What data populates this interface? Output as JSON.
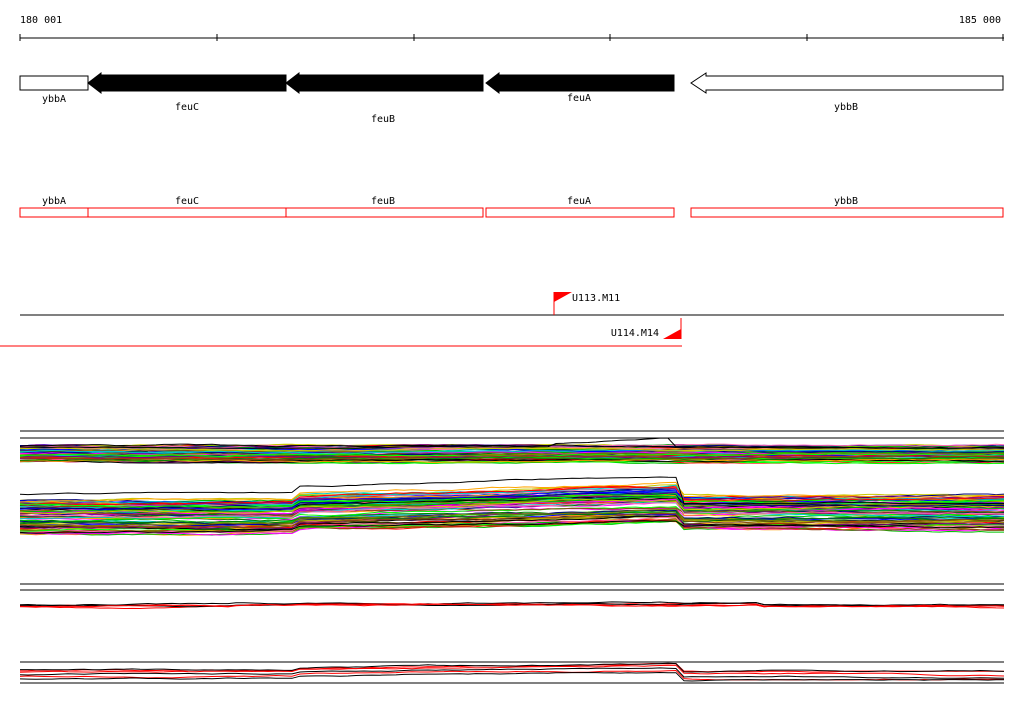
{
  "ruler": {
    "start_label": "180 001",
    "end_label": "185 000"
  },
  "genes": [
    {
      "name": "ybbA",
      "strand": "-",
      "filled": false,
      "label_row": "upper"
    },
    {
      "name": "feuC",
      "strand": "-",
      "filled": true,
      "label_row": "lower"
    },
    {
      "name": "feuB",
      "strand": "-",
      "filled": true,
      "label_row": "lowest"
    },
    {
      "name": "feuA",
      "strand": "-",
      "filled": true,
      "label_row": "upper"
    },
    {
      "name": "ybbB",
      "strand": "-",
      "filled": false,
      "label_row": "lower"
    }
  ],
  "transcripts": [
    {
      "name": "ybbA"
    },
    {
      "name": "feuC"
    },
    {
      "name": "feuB"
    },
    {
      "name": "feuA"
    },
    {
      "name": "ybbB"
    }
  ],
  "promoters": [
    {
      "label": "U113.M11",
      "strand": "+",
      "color": "#ff0000"
    },
    {
      "label": "U114.M14",
      "strand": "-",
      "color": "#ff0000"
    }
  ],
  "expression_panels": [
    {
      "name": "multi-condition-upper",
      "color_scheme": "rainbow"
    },
    {
      "name": "multi-condition-lower",
      "color_scheme": "rainbow"
    },
    {
      "name": "selected-red-black-upper",
      "color_scheme": "red-black"
    },
    {
      "name": "selected-red-black-lower",
      "color_scheme": "red-black"
    }
  ],
  "colors": {
    "gene_fill": "#000000",
    "transcript_outline": "#ff0000",
    "promoter_flag": "#ff0000",
    "axis": "#000000"
  }
}
